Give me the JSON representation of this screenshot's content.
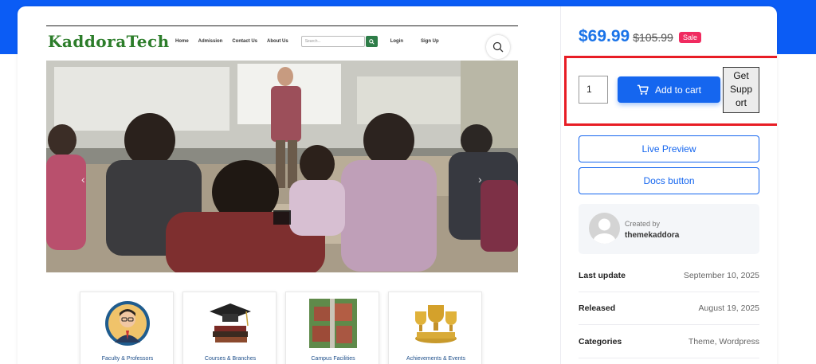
{
  "colors": {
    "accent": "#1566ef",
    "sale": "#f02b60",
    "highlight": "#e81d25",
    "brand_band": "#0b5cf5"
  },
  "preview": {
    "logo": "KaddoraTech",
    "nav": [
      "Home",
      "Admission",
      "Contact Us",
      "About Us"
    ],
    "search_placeholder": "Search...",
    "right_links": [
      "Login",
      "Sign Up"
    ],
    "cards": [
      {
        "label": "Faculty & Professors",
        "icon": "teacher-avatar-icon"
      },
      {
        "label": "Courses & Branches",
        "icon": "graduation-cap-books-icon"
      },
      {
        "label": "Campus Facilities",
        "icon": "campus-buildings-icon"
      },
      {
        "label": "Achievements & Events",
        "icon": "trophies-icon"
      }
    ]
  },
  "product": {
    "price": "$69.99",
    "old_price": "$105.99",
    "sale_badge": "Sale",
    "quantity": "1",
    "add_to_cart": "Add to cart",
    "get_support": "Get\nSupp\nort",
    "live_preview": "Live Preview",
    "docs_button": "Docs button"
  },
  "author": {
    "created_by": "Created by",
    "name": "themekaddora"
  },
  "meta": [
    {
      "key": "Last update",
      "value": "September 10, 2025"
    },
    {
      "key": "Released",
      "value": "August 19, 2025"
    },
    {
      "key": "Categories",
      "value": "Theme, Wordpress"
    }
  ]
}
